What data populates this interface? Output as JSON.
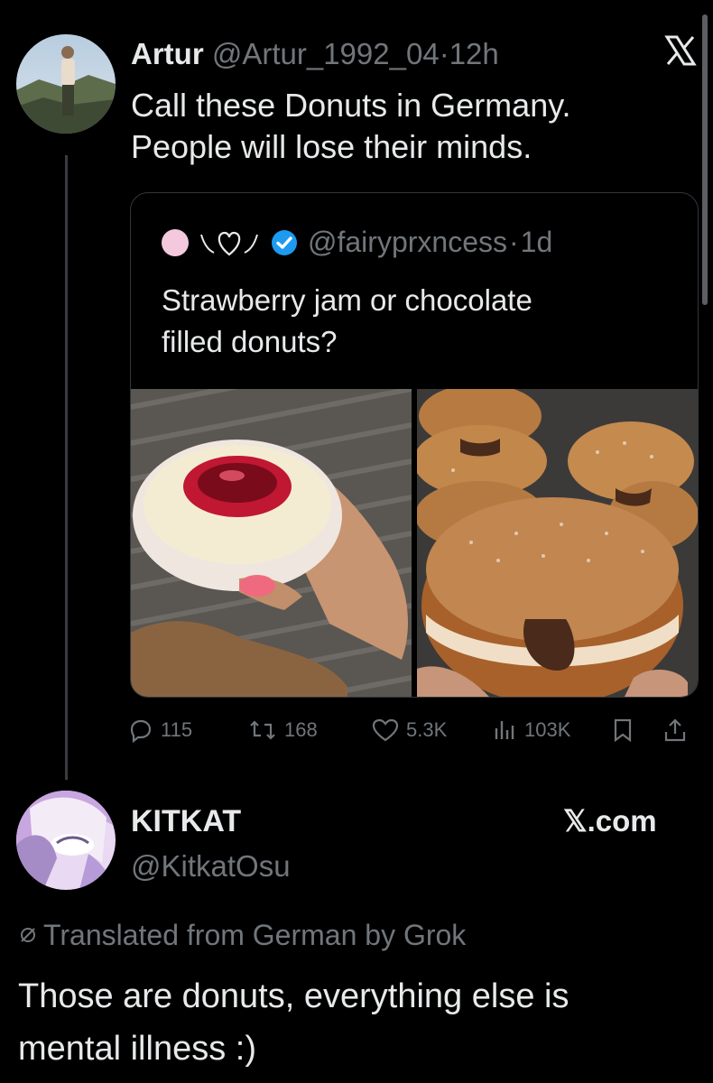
{
  "tweet": {
    "author_name": "Artur",
    "author_handle": "@Artur_1992_04",
    "separator": "·",
    "time": "12h",
    "text_line1": "Call these Donuts in Germany.",
    "text_line2": "People will lose their minds."
  },
  "quoted": {
    "handle": "@fairyprxncess",
    "separator": "·",
    "time": "1d",
    "name_emoji": "⚪︎ꫂ♡ꫂ",
    "text_line1": "Strawberry jam or chocolate",
    "text_line2": "filled donuts?"
  },
  "actions": {
    "replies": "115",
    "reposts": "168",
    "likes": "5.3K",
    "views": "103K"
  },
  "reply": {
    "author_name": "KITΚAT",
    "author_handle": "@KitkatOsu",
    "translated_note": "Translated from German by Grok",
    "text_line1": "Those are donuts, everything else is",
    "text_line2": "mental illness :)"
  },
  "watermark": "𝕏.com",
  "x_logo": "𝕏",
  "icons": [
    "reply-icon",
    "repost-icon",
    "like-icon",
    "views-icon",
    "bookmark-icon",
    "share-icon",
    "verified-badge-icon",
    "translate-icon",
    "x-logo-icon"
  ],
  "colors": {
    "background": "#000000",
    "text": "#e7e9ea",
    "muted": "#71767b",
    "verified": "#1d9bf0",
    "divider": "#333639"
  }
}
